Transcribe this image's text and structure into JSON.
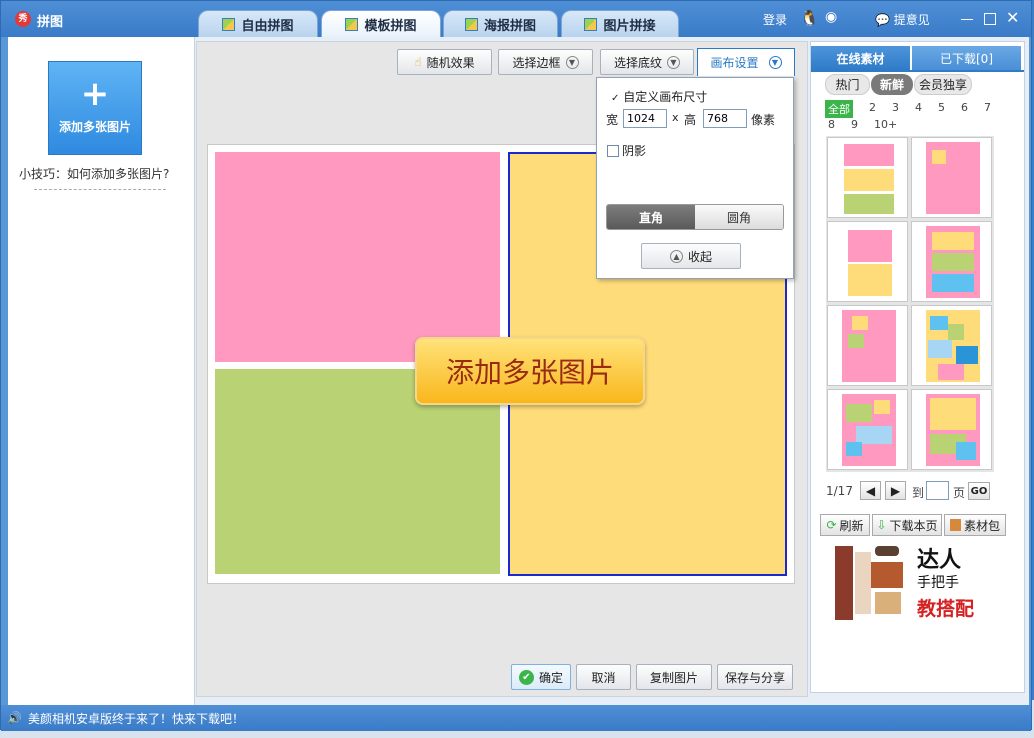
{
  "app": {
    "title": "拼图",
    "logo_text": "秀"
  },
  "tabs": [
    {
      "label": "自由拼图"
    },
    {
      "label": "模板拼图"
    },
    {
      "label": "海报拼图"
    },
    {
      "label": "图片拼接"
    }
  ],
  "titlebar": {
    "login": "登录",
    "feedback": "提意见"
  },
  "left": {
    "add_button": "添加多张图片",
    "tip": "小技巧：如何添加多张图片?"
  },
  "toolbar": {
    "random": "随机效果",
    "border": "选择边框",
    "texture": "选择底纹",
    "canvas": "画布设置"
  },
  "canvas_popup": {
    "custom_size": "自定义画布尺寸",
    "width_label": "宽",
    "width_value": "1024",
    "x": "x",
    "height_label": "高",
    "height_value": "768",
    "unit": "像素",
    "shadow": "阴影",
    "corner_square": "直角",
    "corner_round": "圆角",
    "collapse": "收起"
  },
  "canvas": {
    "center_label": "添加多张图片",
    "cells": [
      {
        "color": "#ff99bf"
      },
      {
        "color": "#b8d274"
      },
      {
        "color": "#ffdc7a"
      }
    ]
  },
  "bottom_buttons": {
    "ok": "确定",
    "cancel": "取消",
    "copy": "复制图片",
    "save": "保存与分享"
  },
  "right": {
    "tab_online": "在线素材",
    "tab_downloaded": "已下载[0]",
    "filters": [
      "热门",
      "新鲜",
      "会员独享"
    ],
    "nums_row1": [
      "全部",
      "2",
      "3",
      "4",
      "5",
      "6",
      "7"
    ],
    "nums_row2": [
      "8",
      "9",
      "10+"
    ],
    "pager": {
      "page": "1/17",
      "goto": "到",
      "page_unit": "页",
      "go": "GO"
    },
    "actions": {
      "refresh": "刷新",
      "download_page": "下载本页",
      "pack": "素材包"
    },
    "ad": {
      "line1": "达人",
      "line2": "手把手",
      "line3": "教搭配"
    }
  },
  "status": {
    "text": "美颜相机安卓版终于来了！快来下载吧！"
  },
  "colors": {
    "pink": "#ff99bf",
    "green": "#b8d274",
    "yellow": "#ffdc7a",
    "accent": "#2a79c6"
  }
}
